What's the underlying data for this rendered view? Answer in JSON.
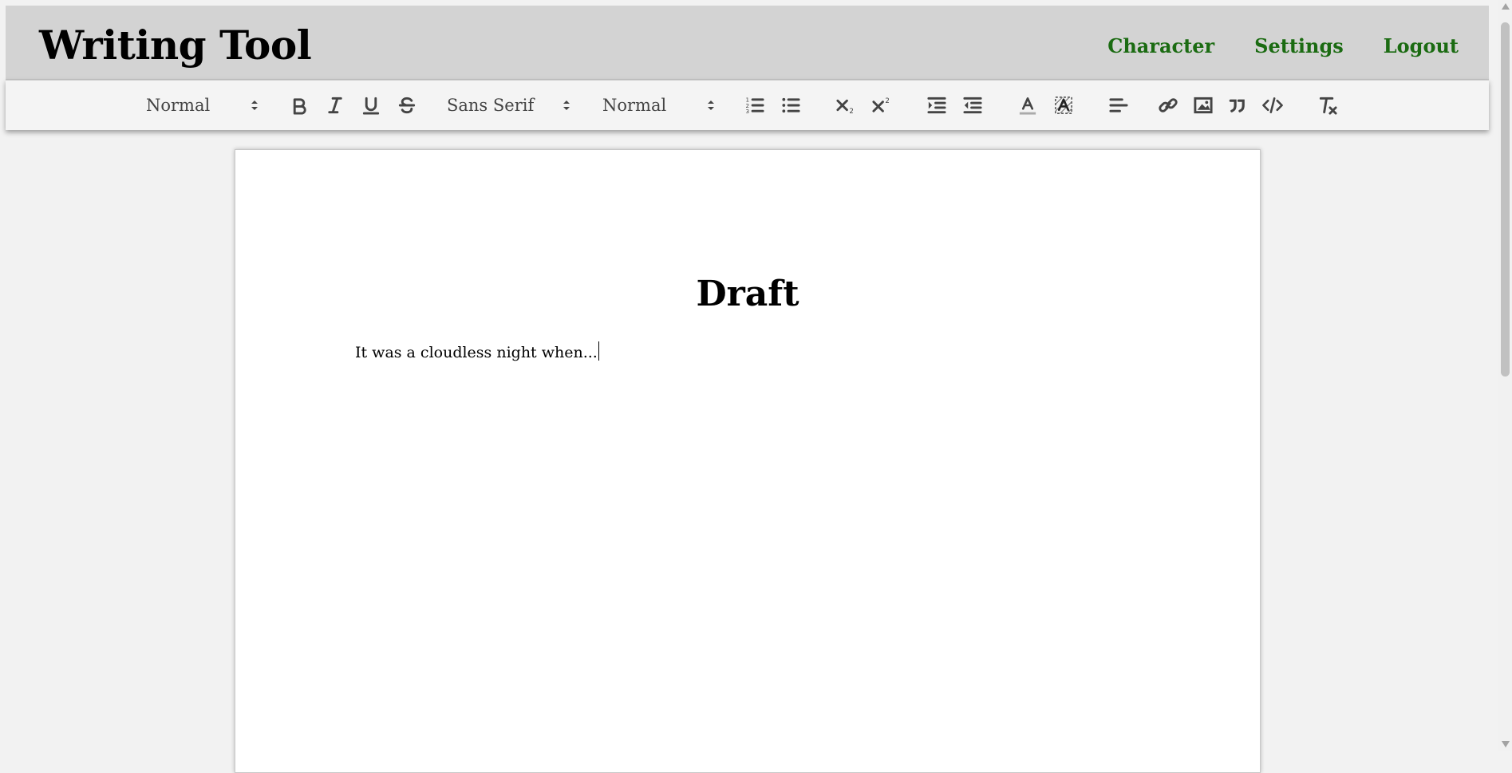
{
  "app": {
    "title": "Writing Tool"
  },
  "nav": {
    "character": "Character",
    "settings": "Settings",
    "logout": "Logout"
  },
  "toolbar": {
    "header_picker": "Normal",
    "font_picker": "Sans Serif",
    "size_picker": "Normal",
    "buttons": [
      "bold",
      "italic",
      "underline",
      "strikethrough",
      "ordered-list",
      "bullet-list",
      "subscript",
      "superscript",
      "indent",
      "outdent",
      "text-color",
      "background-color",
      "align",
      "link",
      "image",
      "blockquote",
      "code",
      "clear-formatting"
    ]
  },
  "document": {
    "title": "Draft",
    "body": "It was a cloudless night when..."
  },
  "colors": {
    "header_bg": "#d3d3d3",
    "nav_link": "#1b6b12",
    "toolbar_bg": "#f4f4f4",
    "canvas_bg": "#f2f2f2"
  }
}
